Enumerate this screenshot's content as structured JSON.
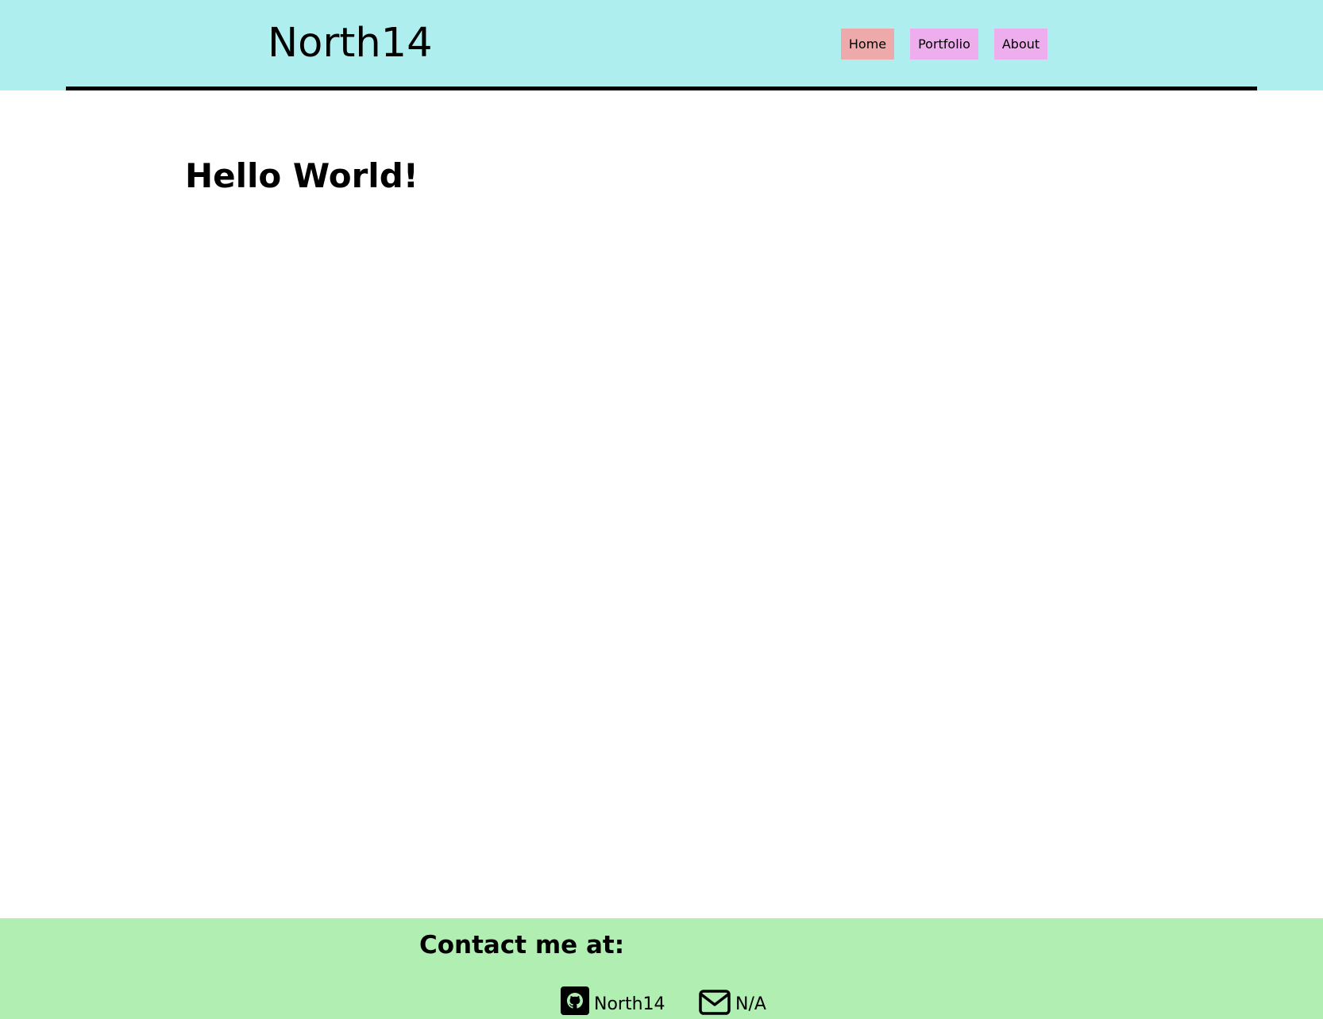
{
  "header": {
    "site_title": "North14",
    "nav": [
      {
        "label": "Home",
        "color": "#eeaaaa"
      },
      {
        "label": "Portfolio",
        "color": "#eeaeee"
      },
      {
        "label": "About",
        "color": "#eeaeee"
      }
    ],
    "background": "#afeeee"
  },
  "main": {
    "heading": "Hello World!"
  },
  "footer": {
    "heading": "Contact me at:",
    "contacts": [
      {
        "icon": "github-icon",
        "label": "North14"
      },
      {
        "icon": "envelope-icon",
        "label": "N/A"
      }
    ],
    "background": "#b0eeb2"
  }
}
